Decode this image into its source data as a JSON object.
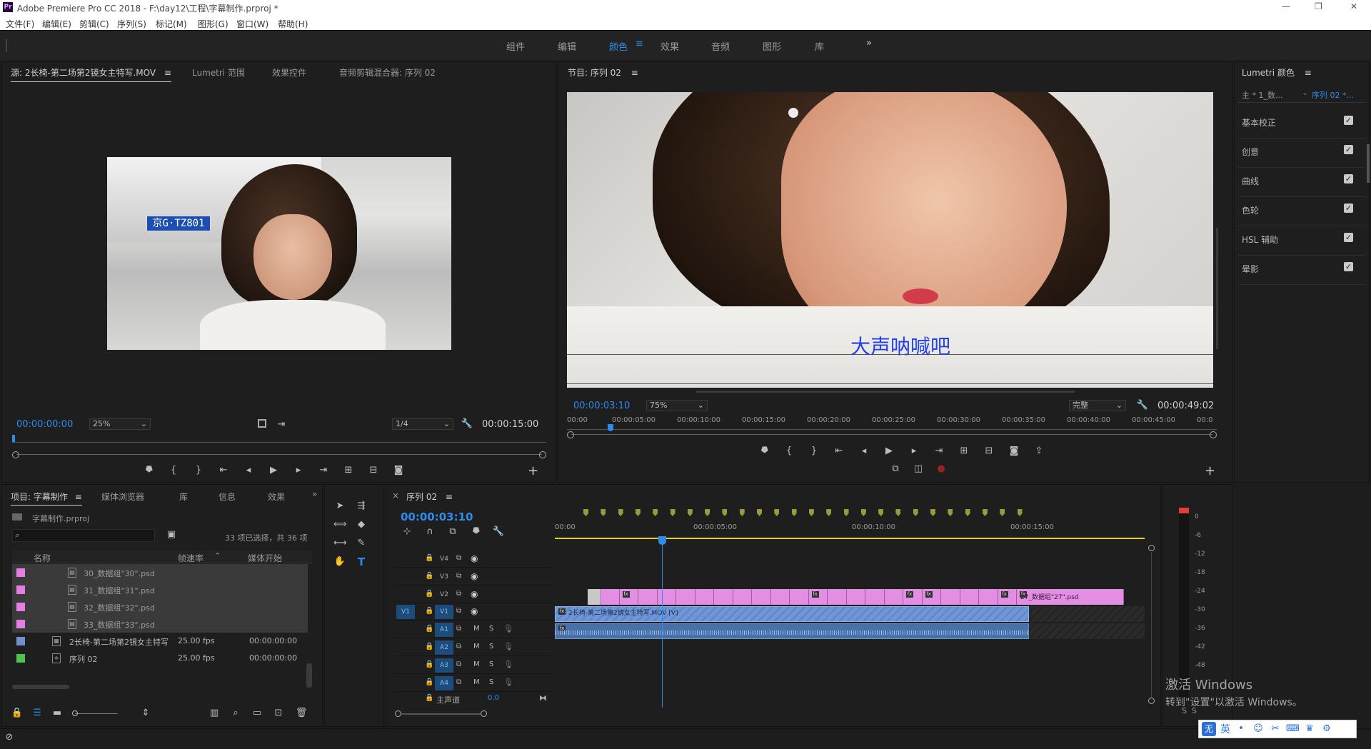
{
  "app": {
    "title": "Adobe Premiere Pro CC 2018 - F:\\day12\\工程\\字幕制作.prproj *",
    "logo": "Pr",
    "window_controls": [
      "—",
      "❐",
      "✕"
    ]
  },
  "menu": [
    "文件(F)",
    "编辑(E)",
    "剪辑(C)",
    "序列(S)",
    "标记(M)",
    "图形(G)",
    "窗口(W)",
    "帮助(H)"
  ],
  "workspaces": {
    "items": [
      "组件",
      "编辑",
      "颜色",
      "效果",
      "音频",
      "图形",
      "库"
    ],
    "active": "颜色",
    "more": "»"
  },
  "source_panel": {
    "tabs": [
      "源: 2长椅-第二场第2镜女主特写.MOV",
      "Lumetri 范围",
      "效果控件",
      "音频剪辑混合器: 序列 02"
    ],
    "timecode": "00:00:00:00",
    "zoom": "25%",
    "resolution": "1/4",
    "duration": "00:00:15:00",
    "playhead_fraction": 0.0
  },
  "program_panel": {
    "title": "节目: 序列 02",
    "caption": "大声呐喊吧",
    "timecode": "00:00:03:10",
    "zoom": "75%",
    "quality": "完整",
    "duration": "00:00:49:02",
    "ruler": [
      "00:00",
      "00:00:05:00",
      "00:00:10:00",
      "00:00:15:00",
      "00:00:20:00",
      "00:00:25:00",
      "00:00:30:00",
      "00:00:35:00",
      "00:00:40:00",
      "00:00:45:00",
      "00:0"
    ],
    "playhead_fraction": 0.063
  },
  "lumetri": {
    "title": "Lumetri 颜色",
    "master": "主 * 1_数...",
    "sequence": "序列 02 *...",
    "sections": [
      {
        "label": "基本校正",
        "checked": true
      },
      {
        "label": "创意",
        "checked": true
      },
      {
        "label": "曲线",
        "checked": true
      },
      {
        "label": "色轮",
        "checked": true
      },
      {
        "label": "HSL 辅助",
        "checked": true
      },
      {
        "label": "晕影",
        "checked": true
      }
    ]
  },
  "project_panel": {
    "tabs": [
      "项目: 字幕制作",
      "媒体浏览器",
      "库",
      "信息",
      "效果"
    ],
    "file": "字幕制作.prproj",
    "selection_status": "33 项已选择，共 36 项",
    "search_placeholder": "",
    "columns": [
      "名称",
      "帧速率",
      "媒体开始"
    ],
    "rows": [
      {
        "color": "#e37ee3",
        "name": "30_数据组\"30\".psd",
        "fps": "",
        "start": "",
        "selected": true,
        "kind": "psd"
      },
      {
        "color": "#e37ee3",
        "name": "31_数据组\"31\".psd",
        "fps": "",
        "start": "",
        "selected": true,
        "kind": "psd"
      },
      {
        "color": "#e37ee3",
        "name": "32_数据组\"32\".psd",
        "fps": "",
        "start": "",
        "selected": true,
        "kind": "psd"
      },
      {
        "color": "#e37ee3",
        "name": "33_数据组\"33\".psd",
        "fps": "",
        "start": "",
        "selected": true,
        "kind": "psd"
      },
      {
        "color": "#6f8fcf",
        "name": "2长椅-第二场第2镜女主特写.MOV",
        "fps": "25.00 fps",
        "start": "00:00:00:00",
        "selected": false,
        "kind": "video"
      },
      {
        "color": "#4dc24d",
        "name": "序列 02",
        "fps": "25.00 fps",
        "start": "00:00:00:00",
        "selected": false,
        "kind": "sequence"
      }
    ]
  },
  "timeline": {
    "title": "序列 02",
    "timecode": "00:00:03:10",
    "ruler": [
      "00:00",
      "00:00:05:00",
      "00:00:10:00",
      "00:00:15:00"
    ],
    "tracks_video": [
      {
        "name": "V4"
      },
      {
        "name": "V3"
      },
      {
        "name": "V2"
      },
      {
        "name": "V1"
      }
    ],
    "tracks_audio": [
      {
        "name": "A1"
      },
      {
        "name": "A2"
      },
      {
        "name": "A3"
      },
      {
        "name": "A4"
      }
    ],
    "v_source": "V1",
    "a_source": "A1",
    "master_label": "主声道",
    "master_value": "0.0",
    "v2_clip_label": "27_数据组\"27\".psd",
    "v1_clip_label": "2长椅-第二场第2镜女主特写.MOV [V]",
    "track_buttons": {
      "mute": "M",
      "solo": "S"
    }
  },
  "meter": {
    "scale": [
      "0",
      "-6",
      "-12",
      "-18",
      "-24",
      "-30",
      "-36",
      "-42",
      "-48"
    ],
    "buttons": [
      "S",
      "S"
    ]
  },
  "watermark": {
    "line1": "激活 Windows",
    "line2": "转到\"设置\"以激活 Windows。"
  },
  "tray": {
    "ime": "英",
    "icon": "无"
  },
  "colors": {
    "accent": "#2d8ceb",
    "pink_clip": "#e28ee2",
    "video_clip": "#6f97d7",
    "playhead": "#2d8ceb"
  }
}
